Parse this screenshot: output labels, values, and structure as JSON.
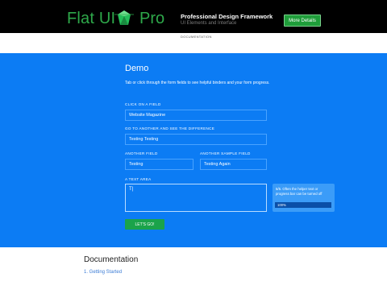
{
  "header": {
    "logo_text": "Flat UI",
    "logo_suffix": "Pro",
    "tagline": "Professional Design Framework",
    "subline": "UI Elements and Interface",
    "more_button": "More Details"
  },
  "nav": {
    "documentation": "DOCUMENTATION"
  },
  "demo": {
    "title": "Demo",
    "description": "Tab or click through the form fields to see helpful binders and your form progress.",
    "fields": [
      {
        "label": "CLICK ON A FIELD",
        "value": "Website Magazine"
      },
      {
        "label": "GO TO ANOTHER AND SEE THE DIFFERENCE",
        "value": "Testing Testing"
      },
      {
        "label": "ANOTHER FIELD",
        "value": "Testing"
      },
      {
        "label": "ANOTHER SAMPLE FIELD",
        "value": "Testing Again"
      }
    ],
    "textarea": {
      "label": "A TEXT AREA",
      "value": "T|"
    },
    "helper": {
      "text": "5/5. Often the helper text or progress bar can be turned off",
      "progress_label": "100%",
      "progress": 1.0
    },
    "submit": "LET'S GO!"
  },
  "bottom": {
    "heading": "Documentation",
    "link": "1. Getting Started"
  },
  "colors": {
    "header_bg": "#000000",
    "brand_green": "#2ea84a",
    "demo_bg": "#0c7cf4",
    "button_green": "#1aa34a"
  }
}
